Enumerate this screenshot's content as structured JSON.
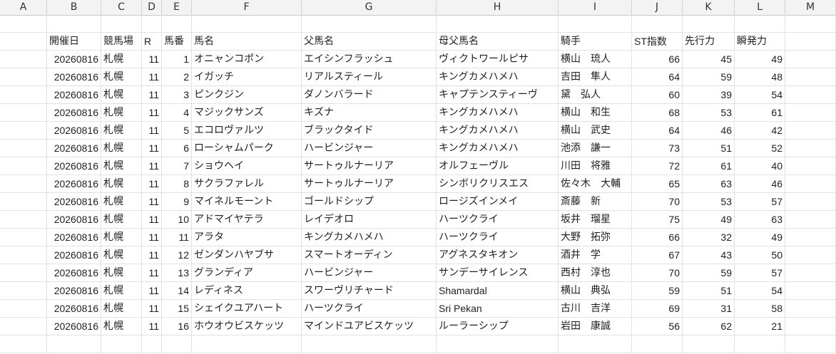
{
  "columns": [
    "A",
    "B",
    "C",
    "D",
    "E",
    "F",
    "G",
    "H",
    "I",
    "J",
    "K",
    "L",
    "M"
  ],
  "headers": [
    "",
    "開催日",
    "競馬場",
    "R",
    "馬番",
    "馬名",
    "父馬名",
    "母父馬名",
    "騎手",
    "ST指数",
    "先行力",
    "瞬発力",
    ""
  ],
  "rows": [
    [
      "20260816",
      "札幌",
      "11",
      "1",
      "オニャンコポン",
      "エイシンフラッシュ",
      "ヴィクトワールピサ",
      "横山　琉人",
      "66",
      "45",
      "49"
    ],
    [
      "20260816",
      "札幌",
      "11",
      "2",
      "イガッチ",
      "リアルスティール",
      "キングカメハメハ",
      "吉田　隼人",
      "64",
      "59",
      "48"
    ],
    [
      "20260816",
      "札幌",
      "11",
      "3",
      "ピンクジン",
      "ダノンバラード",
      "キャプテンスティーヴ",
      "黛　弘人",
      "60",
      "39",
      "54"
    ],
    [
      "20260816",
      "札幌",
      "11",
      "4",
      "マジックサンズ",
      "キズナ",
      "キングカメハメハ",
      "横山　和生",
      "68",
      "53",
      "61"
    ],
    [
      "20260816",
      "札幌",
      "11",
      "5",
      "エコロヴァルツ",
      "ブラックタイド",
      "キングカメハメハ",
      "横山　武史",
      "64",
      "46",
      "42"
    ],
    [
      "20260816",
      "札幌",
      "11",
      "6",
      "ローシャムパーク",
      "ハービンジャー",
      "キングカメハメハ",
      "池添　謙一",
      "73",
      "51",
      "52"
    ],
    [
      "20260816",
      "札幌",
      "11",
      "7",
      "ショウヘイ",
      "サートゥルナーリア",
      "オルフェーヴル",
      "川田　将雅",
      "72",
      "61",
      "40"
    ],
    [
      "20260816",
      "札幌",
      "11",
      "8",
      "サクラファレル",
      "サートゥルナーリア",
      "シンボリクリスエス",
      "佐々木　大輔",
      "65",
      "63",
      "46"
    ],
    [
      "20260816",
      "札幌",
      "11",
      "9",
      "マイネルモーント",
      "ゴールドシップ",
      "ロージズインメイ",
      "斎藤　新",
      "70",
      "53",
      "57"
    ],
    [
      "20260816",
      "札幌",
      "11",
      "10",
      "アドマイヤテラ",
      "レイデオロ",
      "ハーツクライ",
      "坂井　瑠星",
      "75",
      "49",
      "63"
    ],
    [
      "20260816",
      "札幌",
      "11",
      "11",
      "アラタ",
      "キングカメハメハ",
      "ハーツクライ",
      "大野　拓弥",
      "66",
      "32",
      "49"
    ],
    [
      "20260816",
      "札幌",
      "11",
      "12",
      "ゼンダンハヤブサ",
      "スマートオーディン",
      "アグネスタキオン",
      "酒井　学",
      "67",
      "43",
      "50"
    ],
    [
      "20260816",
      "札幌",
      "11",
      "13",
      "グランディア",
      "ハービンジャー",
      "サンデーサイレンス",
      "西村　淳也",
      "70",
      "59",
      "57"
    ],
    [
      "20260816",
      "札幌",
      "11",
      "14",
      "レディネス",
      "スワーヴリチャード",
      "Shamardal",
      "横山　典弘",
      "59",
      "51",
      "54"
    ],
    [
      "20260816",
      "札幌",
      "11",
      "15",
      "シェイクユアハート",
      "ハーツクライ",
      "Sri Pekan",
      "古川　吉洋",
      "69",
      "31",
      "58"
    ],
    [
      "20260816",
      "札幌",
      "11",
      "16",
      "ホウオウビスケッツ",
      "マインドユアビスケッツ",
      "ルーラーシップ",
      "岩田　康誠",
      "56",
      "62",
      "21"
    ]
  ]
}
